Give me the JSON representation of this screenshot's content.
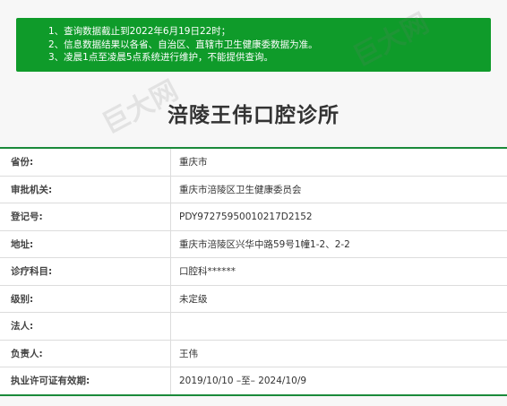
{
  "notice": {
    "lines": [
      "1、查询数据截止到2022年6月19日22时；",
      "2、信息数据结果以各省、自治区、直辖市卫生健康委数据为准。",
      "3、凌晨1点至凌晨5点系统进行维护，不能提供查询。"
    ]
  },
  "watermark": {
    "text": "巨大网",
    "url": "www.cnjuda.com"
  },
  "title": "涪陵王伟口腔诊所",
  "rows": [
    {
      "label": "省份:",
      "value": "重庆市"
    },
    {
      "label": "审批机关:",
      "value": "重庆市涪陵区卫生健康委员会"
    },
    {
      "label": "登记号:",
      "value": "PDY97275950010217D2152"
    },
    {
      "label": "地址:",
      "value": "重庆市涪陵区兴华中路59号1幢1-2、2-2"
    },
    {
      "label": "诊疗科目:",
      "value": "口腔科******"
    },
    {
      "label": "级别:",
      "value": "未定级"
    },
    {
      "label": "法人:",
      "value": ""
    },
    {
      "label": "负责人:",
      "value": "王伟"
    },
    {
      "label": "执业许可证有效期:",
      "value": "2019/10/10 –至– 2024/10/9"
    }
  ],
  "colors": {
    "notice_bg": "#0f9b2a",
    "table_border_accent": "#1a8a3a"
  }
}
